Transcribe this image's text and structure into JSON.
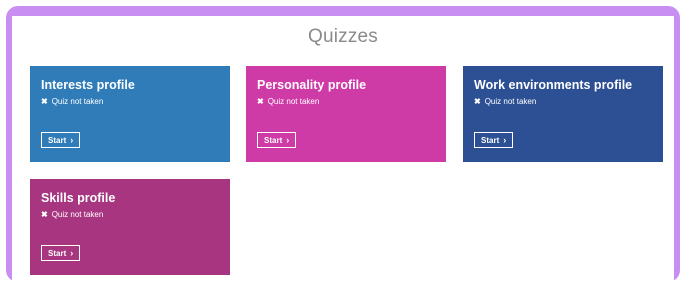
{
  "header": {
    "title": "Quizzes"
  },
  "colors": {
    "frame": "#c88ef2",
    "interests": "#2f7cb9",
    "personality": "#cf3ba6",
    "work": "#2d5095",
    "skills": "#a7357f"
  },
  "cards": [
    {
      "title": "Interests profile",
      "status": "Quiz not taken",
      "button": "Start",
      "status_icon": "x-icon",
      "button_icon": "chevron-right-icon"
    },
    {
      "title": "Personality profile",
      "status": "Quiz not taken",
      "button": "Start",
      "status_icon": "x-icon",
      "button_icon": "chevron-right-icon"
    },
    {
      "title": "Work environments profile",
      "status": "Quiz not taken",
      "button": "Start",
      "status_icon": "x-icon",
      "button_icon": "chevron-right-icon"
    },
    {
      "title": "Skills profile",
      "status": "Quiz not taken",
      "button": "Start",
      "status_icon": "x-icon",
      "button_icon": "chevron-right-icon"
    }
  ]
}
